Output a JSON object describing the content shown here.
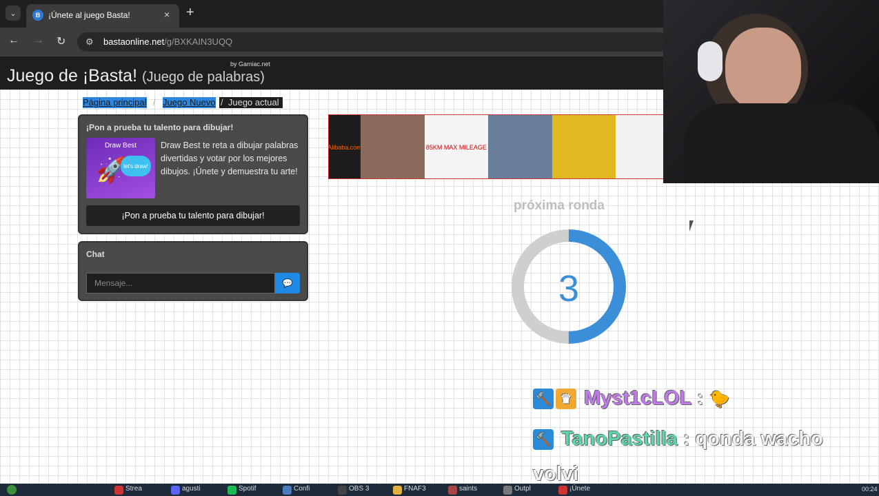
{
  "browser": {
    "tab_title": "¡Únete al juego Basta!",
    "tab_close": "×",
    "new_tab": "+",
    "url_domain": "bastaonline.net",
    "url_path": "/g/BXKAIN3UQQ"
  },
  "site": {
    "title": "Juego de ¡Basta!",
    "subtitle": "(Juego de palabras)",
    "by_label": "by Gamiac.net"
  },
  "breadcrumb": {
    "home": "Página principal",
    "sep1": "/",
    "new_game": "Juego Nuevo",
    "sep2": "/",
    "current": "Juego actual"
  },
  "promo": {
    "heading": "¡Pon a prueba tu talento para dibujar!",
    "thumb_title": "Draw Best",
    "thumb_bubble": "let's draw!",
    "description": "Draw Best te reta a dibujar palabras divertidas y votar por los mejores dibujos. ¡Únete y demuestra tu arte!",
    "button": "¡Pon a prueba tu talento para dibujar!"
  },
  "chat": {
    "title": "Chat",
    "placeholder": "Mensaje..."
  },
  "ad": {
    "brand": "Alibaba.com",
    "items": [
      "",
      "85KM MAX MILEAGE",
      "",
      "",
      ""
    ]
  },
  "round": {
    "label": "próxima ronda",
    "countdown": "3",
    "progress_fraction": 0.5
  },
  "stream_chat": [
    {
      "user": "Myst1cLOL",
      "sep": ":",
      "message": "",
      "user_color": "#c07be8"
    },
    {
      "user": "TanoPastilla",
      "sep": ":",
      "message": "qonda wacho",
      "message_cont": "volvi",
      "user_color": "#5fd4a8"
    }
  ],
  "taskbar": {
    "items": [
      "Strea",
      "agusti",
      "Spotif",
      "Confi",
      "OBS 3",
      "FNAF3",
      "saints",
      "Outpl",
      "¡Únete"
    ],
    "clock": "00:24"
  },
  "colors": {
    "accent": "#3a8fd8",
    "ring_track": "#cfcfcf",
    "dark_panel": "#4a4a4a"
  }
}
